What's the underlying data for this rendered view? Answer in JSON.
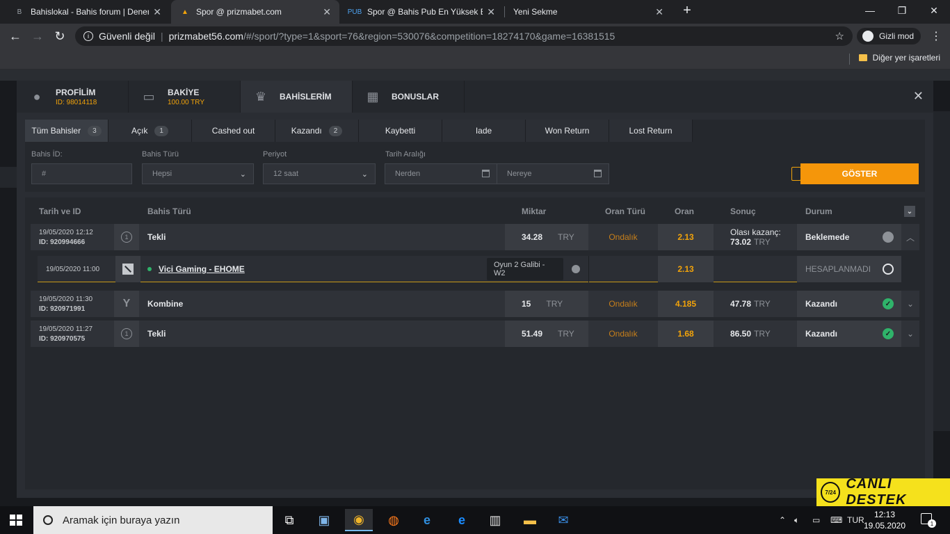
{
  "browser": {
    "tabs": [
      {
        "title": "Bahislokal - Bahis forum | Deneme",
        "fav": "B"
      },
      {
        "title": "Spor @ prizmabet.com",
        "fav": "▲"
      },
      {
        "title": "Spor @ Bahis Pub En Yüksek Bahis",
        "fav": "PUB"
      },
      {
        "title": "Yeni Sekme",
        "fav": ""
      }
    ],
    "security": "Güvenli değil",
    "host": "prizmabet56.com",
    "path": "/#/sport/?type=1&sport=76&region=530076&competition=18274170&game=16381515",
    "incognito": "Gizli mod",
    "bookmarks_label": "Diğer yer işaretleri"
  },
  "modal": {
    "tabs": [
      {
        "label": "PROFİLİM",
        "sub": "ID: 98014118",
        "icon": "user-icon"
      },
      {
        "label": "BAKİYE",
        "sub": "100.00 TRY",
        "icon": "wallet-icon"
      },
      {
        "label": "BAHİSLERİM",
        "sub": "",
        "icon": "trophy-icon"
      },
      {
        "label": "BONUSLAR",
        "sub": "",
        "icon": "gift-icon"
      }
    ],
    "filter_tabs": [
      {
        "label": "Tüm Bahisler",
        "count": "3"
      },
      {
        "label": "Açık",
        "count": "1"
      },
      {
        "label": "Cashed out",
        "count": ""
      },
      {
        "label": "Kazandı",
        "count": "2"
      },
      {
        "label": "Kaybetti",
        "count": ""
      },
      {
        "label": "Iade",
        "count": ""
      },
      {
        "label": "Won Return",
        "count": ""
      },
      {
        "label": "Lost Return",
        "count": ""
      }
    ],
    "filters": {
      "bet_id_label": "Bahis İD:",
      "bet_id_placeholder": "#",
      "bet_type_label": "Bahis Türü",
      "bet_type_value": "Hepsi",
      "period_label": "Periyot",
      "period_value": "12 saat",
      "date_range_label": "Tarih Aralığı",
      "from_placeholder": "Nerden",
      "to_placeholder": "Nereye",
      "show_button": "GÖSTER"
    },
    "table": {
      "headers": {
        "date_id": "Tarih ve ID",
        "bet_type": "Bahis Türü",
        "amount": "Miktar",
        "odds_type": "Oran Türü",
        "odds": "Oran",
        "result": "Sonuç",
        "status": "Durum"
      },
      "rows": [
        {
          "date": "19/05/2020 12:12",
          "id": "ID: 920994666",
          "type": "Tekli",
          "amount": "34.28",
          "currency": "TRY",
          "odds_type": "Ondalık",
          "odds": "2.13",
          "result_label": "Olası kazanç:",
          "result": "73.02",
          "result_currency": "TRY",
          "status": "Beklemede"
        },
        {
          "date": "19/05/2020 11:30",
          "id": "ID: 920971991",
          "type": "Kombine",
          "amount": "15",
          "currency": "TRY",
          "odds_type": "Ondalık",
          "odds": "4.185",
          "result_label": "",
          "result": "47.78",
          "result_currency": "TRY",
          "status": "Kazandı"
        },
        {
          "date": "19/05/2020 11:27",
          "id": "ID: 920970575",
          "type": "Tekli",
          "amount": "51.49",
          "currency": "TRY",
          "odds_type": "Ondalık",
          "odds": "1.68",
          "result_label": "",
          "result": "86.50",
          "result_currency": "TRY",
          "status": "Kazandı"
        }
      ],
      "selection": {
        "date": "19/05/2020 11:00",
        "match": "Vici Gaming - EHOME",
        "market": "Oyun 2 Galibi - W2",
        "odds": "2.13",
        "status": "HESAPLANMADI"
      }
    }
  },
  "support": {
    "badge": "7/24",
    "label": "CANLI DESTEK"
  },
  "taskbar": {
    "search_placeholder": "Aramak için buraya yazın",
    "lang": "TUR",
    "time": "12:13",
    "date": "19.05.2020",
    "notifications": "1"
  },
  "colors": {
    "accent": "#f5960a",
    "win": "#2fb36a",
    "odds": "#f2a30a"
  }
}
